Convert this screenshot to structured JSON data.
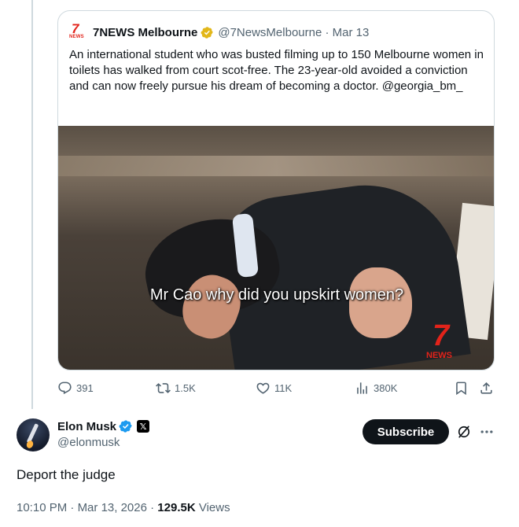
{
  "quoted_tweet": {
    "author_name": "7NEWS Melbourne",
    "handle": "@7NewsMelbourne",
    "date": "Mar 13",
    "text": "An international student who was busted filming up to 150 Melbourne women in toilets has walked from court scot-free. The 23-year-old avoided a conviction and can now freely pursue his dream of becoming a doctor. @georgia_bm_",
    "video_caption": "Mr Cao why did you upskirt women?",
    "logo_text": "NEWS",
    "watermark_text": "NEWS"
  },
  "actions": {
    "replies": "391",
    "reposts": "1.5K",
    "likes": "11K",
    "views": "380K"
  },
  "tweet": {
    "author_name": "Elon Musk",
    "handle": "@elonmusk",
    "subscribe_label": "Subscribe",
    "text": "Deport the judge",
    "time": "10:10 PM",
    "date": "Mar 13, 2026",
    "views_count": "129.5K",
    "views_label": "Views"
  },
  "icons": {
    "reply": "reply-icon",
    "repost": "repost-icon",
    "like": "like-icon",
    "views": "views-icon",
    "bookmark": "bookmark-icon",
    "share": "share-icon",
    "grok": "grok-icon",
    "more": "more-icon"
  },
  "colors": {
    "text_primary": "#0f1419",
    "text_secondary": "#536471",
    "border": "#cfd9de",
    "verified_blue": "#1d9bf0",
    "verified_gold": "#e2b719",
    "brand_red": "#e2231a"
  }
}
